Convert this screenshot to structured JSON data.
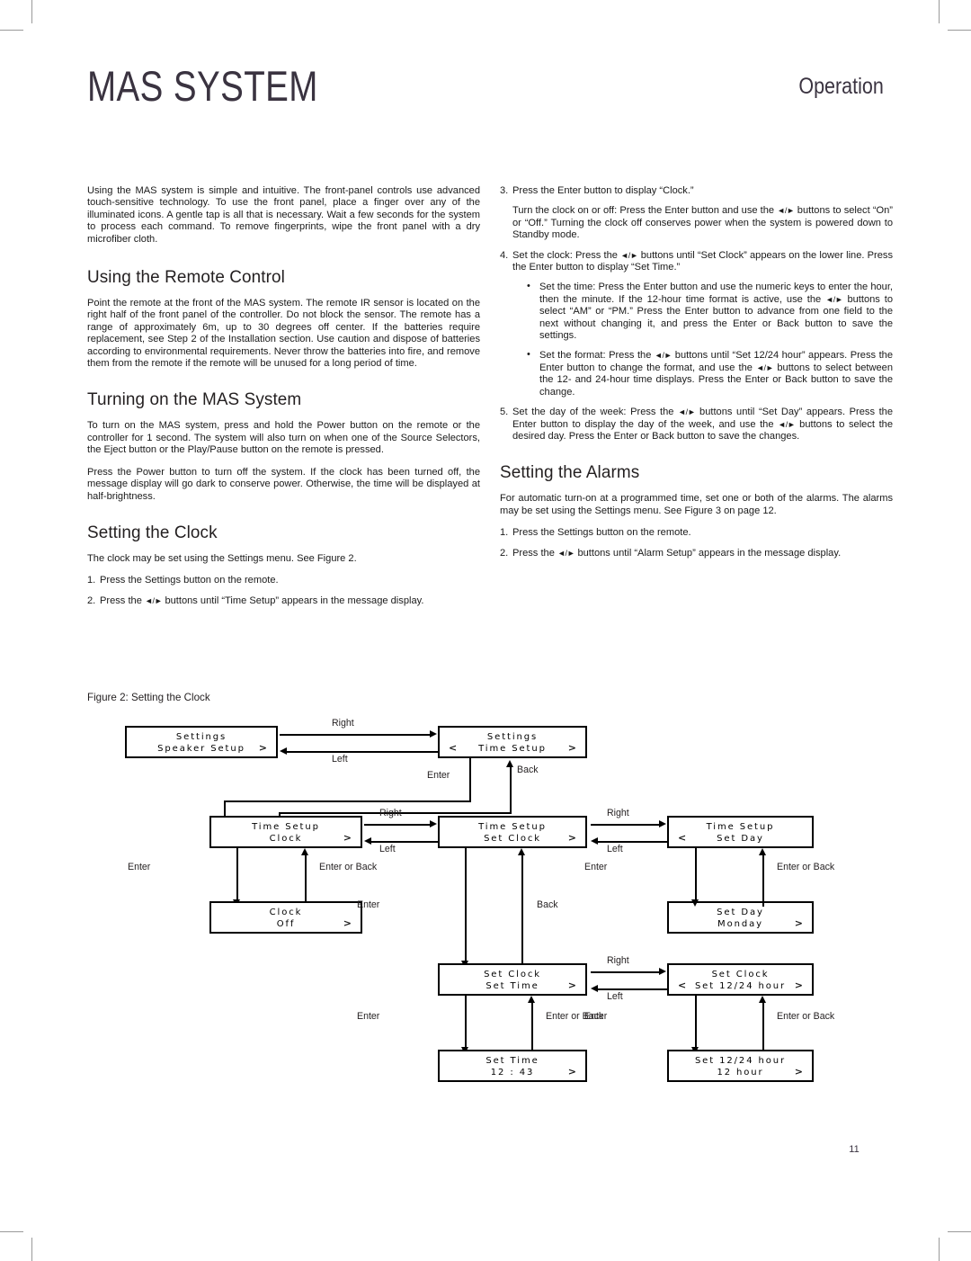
{
  "header": {
    "brand": "MAS SYSTEM",
    "section": "Operation"
  },
  "page_number": "11",
  "left_column": {
    "intro": "Using the MAS system is simple and intuitive. The front-panel controls use advanced touch-sensitive technology. To use the front panel, place a finger over any of the illuminated icons. A gentle tap is all that is necessary. Wait a few seconds for the system to process each command. To remove fingerprints, wipe the front panel with a dry microfiber cloth.",
    "heading_remote": "Using the Remote Control",
    "remote_para": "Point the remote at the front of the MAS system. The remote IR sensor is located on the right half of the front panel of the controller. Do not block the sensor. The remote has a range of approximately 6m, up to 30 degrees off center. If the batteries require replacement, see Step 2 of the Installation section. Use caution and dispose of batteries according to environmental requirements. Never throw the batteries into fire, and remove them from the remote if the remote will be unused for a long period of time.",
    "heading_turning_on": "Turning on the MAS System",
    "turning_on_para1": "To turn on the MAS system, press and hold the Power button on the remote or the controller for 1 second. The system will also turn on when one of the Source Selectors, the Eject button or the Play/Pause button on the remote is pressed.",
    "turning_on_para2": "Press the Power button to turn off the system. If the clock has been turned off, the message display will go dark to conserve power. Otherwise, the time will be displayed at half-brightness.",
    "heading_clock": "Setting the Clock",
    "clock_intro": "The clock may be set using the Settings menu. See Figure 2.",
    "clock_step1_num": "1.",
    "clock_step1": "Press the Settings button on the remote.",
    "clock_step2_num": "2.",
    "clock_step2_a": "Press the ",
    "clock_step2_arrows": "◄/►",
    "clock_step2_b": " buttons until “Time Setup” appears in the message display."
  },
  "right_column": {
    "step3_num": "3.",
    "step3": "Press the Enter button to display “Clock.”",
    "step3_sub_a": "Turn the clock on or off: Press the Enter button and use the ",
    "step3_sub_arrows": "◄/►",
    "step3_sub_b": " buttons to select “On” or “Off.” Turning the clock off conserves power when the system is powered down to Standby mode.",
    "step4_num": "4.",
    "step4_a": "Set the clock: Press the ",
    "step4_arrows": "◄/►",
    "step4_b": " buttons until “Set Clock” appears on the lower line. Press the Enter button to display “Set Time.”",
    "bullet1_a": "Set the time: Press the Enter button and use the numeric keys to enter the hour, then the minute. If the 12-hour time format is active, use the ",
    "bullet1_arrows": "◄/►",
    "bullet1_b": " buttons to select “AM” or “PM.” Press the Enter button to advance from one field to the next without changing it, and press the Enter or Back button to save the settings.",
    "bullet2_a": "Set the format: Press the ",
    "bullet2_arrows1": "◄/►",
    "bullet2_b": " buttons until “Set 12/24 hour” appears. Press the Enter button to change the format, and use the ",
    "bullet2_arrows2": "◄/►",
    "bullet2_c": " buttons to select between the 12- and 24-hour time displays. Press the Enter or Back button to save the change.",
    "step5_num": "5.",
    "step5_a": "Set the day of the week: Press the ",
    "step5_arrows1": "◄/►",
    "step5_b": " buttons until “Set Day” appears. Press the Enter button to display the day of the week, and use the ",
    "step5_arrows2": "◄/►",
    "step5_c": " buttons to select the desired day. Press the Enter or Back button to save the changes.",
    "heading_alarms": "Setting the Alarms",
    "alarms_intro": "For automatic turn-on at a programmed time, set one or both of the alarms. The alarms may be set using the Settings menu. See Figure 3 on page 12.",
    "alarm_step1_num": "1.",
    "alarm_step1": "Press the Settings button on the remote.",
    "alarm_step2_num": "2.",
    "alarm_step2_a": "Press the ",
    "alarm_step2_arrows": "◄/►",
    "alarm_step2_b": " buttons until “Alarm Setup” appears in the message display."
  },
  "figure": {
    "caption": "Figure 2: Setting the Clock",
    "boxes": {
      "settings_speaker": {
        "line1": "Settings",
        "line2": "Speaker Setup",
        "left_mark": "",
        "right_mark": ">"
      },
      "settings_time": {
        "line1": "Settings",
        "line2": "Time Setup",
        "left_mark": "<",
        "right_mark": ">"
      },
      "time_clock": {
        "line1": "Time Setup",
        "line2": "Clock",
        "left_mark": "",
        "right_mark": ">"
      },
      "time_setclock": {
        "line1": "Time Setup",
        "line2": "Set Clock",
        "left_mark": "",
        "right_mark": ">"
      },
      "time_setday": {
        "line1": "Time Setup",
        "line2": "Set Day",
        "left_mark": "<",
        "right_mark": ""
      },
      "clock_off": {
        "line1": "Clock",
        "line2": "Off",
        "left_mark": "",
        "right_mark": ">"
      },
      "setday_monday": {
        "line1": "Set Day",
        "line2": "Monday",
        "left_mark": "",
        "right_mark": ">"
      },
      "setclock_settime": {
        "line1": "Set Clock",
        "line2": "Set Time",
        "left_mark": "",
        "right_mark": ">"
      },
      "setclock_1224": {
        "line1": "Set Clock",
        "line2": "Set 12/24 hour",
        "left_mark": "<",
        "right_mark": ">"
      },
      "settime_value": {
        "line1": "Set Time",
        "line2": "12 : 43",
        "left_mark": "",
        "right_mark": ">"
      },
      "set1224_value": {
        "line1": "Set 12/24 hour",
        "line2": "12 hour",
        "left_mark": "",
        "right_mark": ">"
      }
    },
    "labels": {
      "right1": "Right",
      "left1": "Left",
      "enter1": "Enter",
      "back1": "Back",
      "right2": "Right",
      "left2": "Left",
      "right3": "Right",
      "left3": "Left",
      "enter2": "Enter",
      "enter_or_back1": "Enter or Back",
      "enter3": "Enter",
      "back2": "Back",
      "enter4": "Enter",
      "enter_or_back2": "Enter or Back",
      "right4": "Right",
      "left4": "Left",
      "enter5": "Enter",
      "enter_or_back3": "Enter or Back",
      "enter6": "Enter",
      "enter_or_back4": "Enter or Back"
    }
  }
}
